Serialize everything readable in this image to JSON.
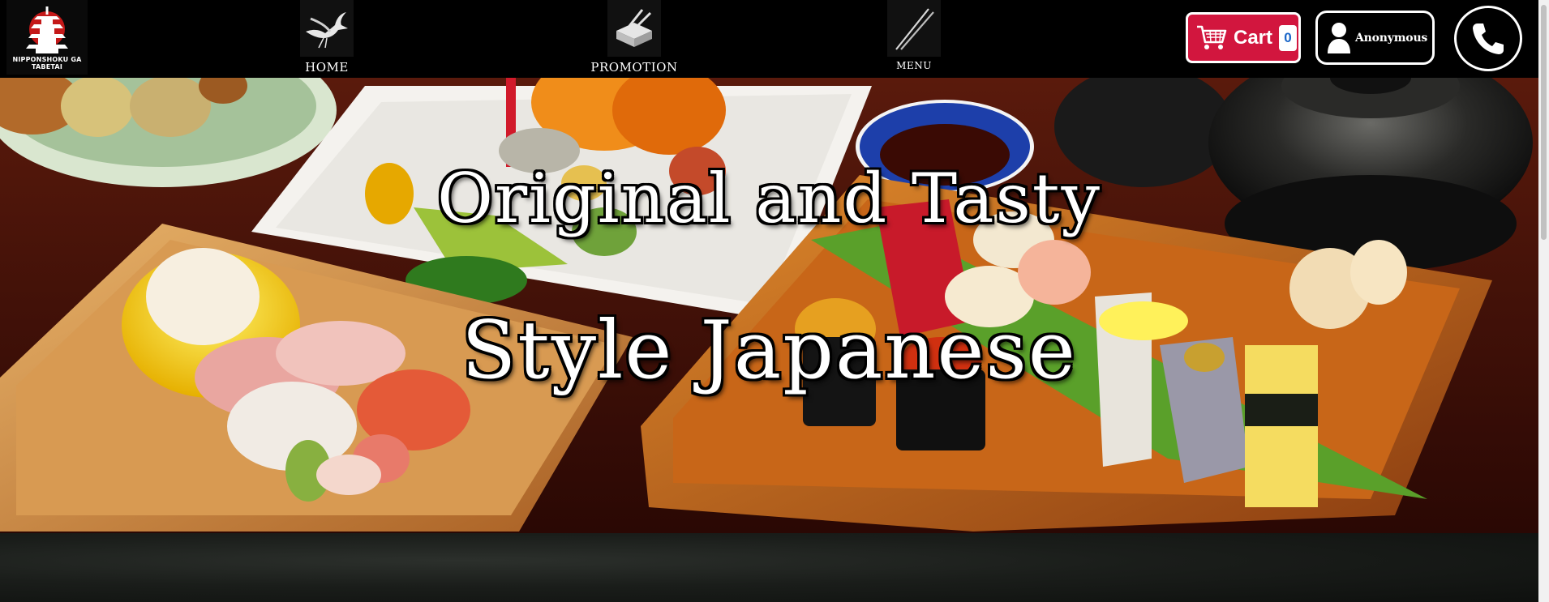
{
  "logo": {
    "text_line1": "NIPPONSHOKU GA",
    "text_line2": "TABETAI",
    "icon": "pagoda-icon"
  },
  "nav": [
    {
      "label": "HOME",
      "icon": "crane-icon"
    },
    {
      "label": "PROMOTION",
      "icon": "sushi-chopsticks-icon"
    },
    {
      "label": "MENU",
      "icon": "chopsticks-icon"
    }
  ],
  "cart": {
    "label": "Cart",
    "count": "0",
    "color": "#d2163e",
    "icon": "cart-icon"
  },
  "user": {
    "label": "Anonymous",
    "icon": "user-icon"
  },
  "phone": {
    "icon": "phone-icon"
  },
  "hero": {
    "line1": "Original and Tasty",
    "line2": "Style Japanese"
  }
}
